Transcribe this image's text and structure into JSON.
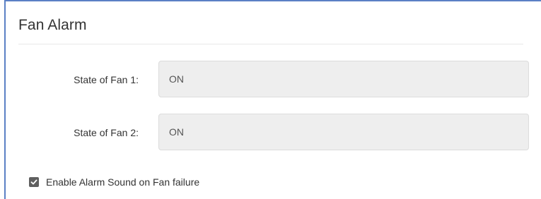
{
  "panel": {
    "title": "Fan Alarm"
  },
  "fields": [
    {
      "label": "State of Fan 1:",
      "value": "ON"
    },
    {
      "label": "State of Fan 2:",
      "value": "ON"
    }
  ],
  "alarm_sound": {
    "label": "Enable Alarm Sound on Fan failure",
    "checked": true
  },
  "colors": {
    "accent_border": "#5b80c5",
    "field_background": "#eeeeee",
    "checkbox_fill": "#5f5f5f"
  },
  "icons": {
    "checkbox": "checkmark-icon"
  }
}
